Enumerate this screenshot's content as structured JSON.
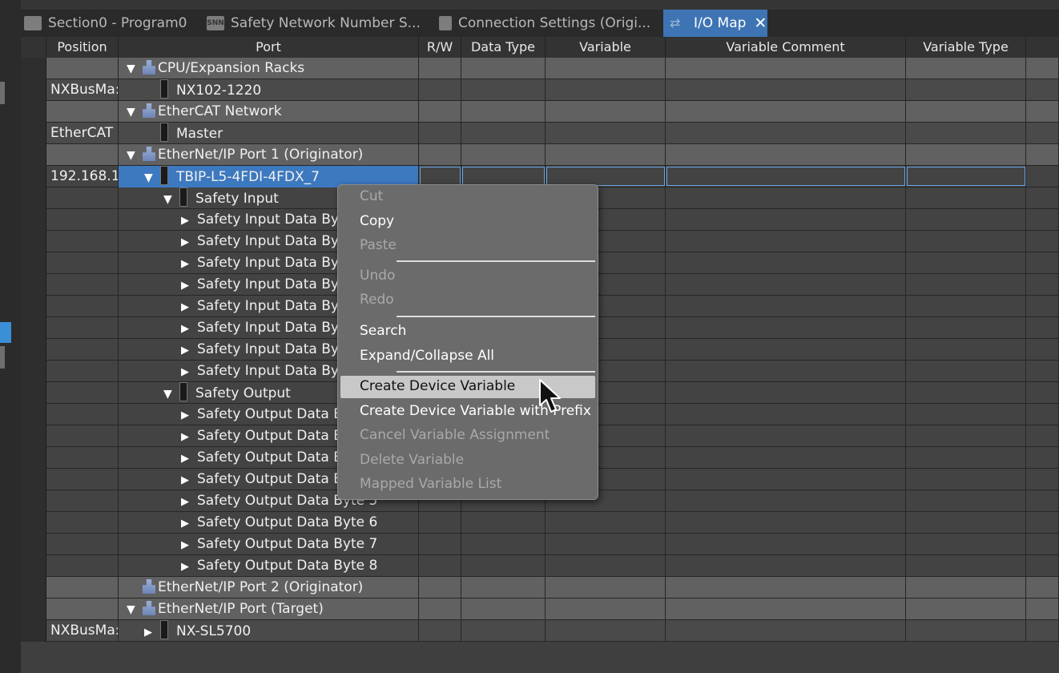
{
  "tabs": [
    {
      "label": "Section0 - Program0",
      "icon": "program-icon",
      "active": false
    },
    {
      "label": "Safety Network Number S...",
      "icon": "snn-icon",
      "badge": "SNN",
      "active": false
    },
    {
      "label": "Connection Settings (Origi...",
      "icon": "connection-icon",
      "active": false
    },
    {
      "label": "I/O Map",
      "icon": "io-map-icon",
      "active": true,
      "close": "✕"
    }
  ],
  "columns": [
    "Position",
    "Port",
    "R/W",
    "Data Type",
    "Variable",
    "Variable Comment",
    "Variable Type"
  ],
  "rows": [
    {
      "type": "cat",
      "position": "",
      "port": "CPU/Expansion Racks",
      "level": 0,
      "expander": "▼",
      "icon": "net"
    },
    {
      "type": "dev",
      "position": "NXBusMa:",
      "port": "NX102-1220",
      "level": 1,
      "expander": "",
      "icon": "dev"
    },
    {
      "type": "cat",
      "position": "",
      "port": "EtherCAT Network",
      "level": 0,
      "expander": "▼",
      "icon": "net"
    },
    {
      "type": "dev",
      "position": "EtherCAT I",
      "port": "Master",
      "level": 1,
      "expander": "",
      "icon": "dev"
    },
    {
      "type": "cat",
      "position": "",
      "port": "EtherNet/IP Port 1 (Originator)",
      "level": 0,
      "expander": "▼",
      "icon": "net"
    },
    {
      "type": "sel",
      "position": "192.168.1.",
      "port": "TBIP-L5-4FDI-4FDX_7",
      "level": 1,
      "expander": "▼",
      "icon": "dev"
    },
    {
      "type": "plain",
      "position": "",
      "port": "Safety Input",
      "level": 2,
      "expander": "▼",
      "icon": "dev"
    },
    {
      "type": "plain",
      "position": "",
      "port": "Safety Input Data Byte 1",
      "level": 3,
      "expander": "▶",
      "icon": ""
    },
    {
      "type": "plain",
      "position": "",
      "port": "Safety Input Data Byte 2",
      "level": 3,
      "expander": "▶",
      "icon": ""
    },
    {
      "type": "plain",
      "position": "",
      "port": "Safety Input Data Byte 3",
      "level": 3,
      "expander": "▶",
      "icon": ""
    },
    {
      "type": "plain",
      "position": "",
      "port": "Safety Input Data Byte 4",
      "level": 3,
      "expander": "▶",
      "icon": ""
    },
    {
      "type": "plain",
      "position": "",
      "port": "Safety Input Data Byte 5",
      "level": 3,
      "expander": "▶",
      "icon": ""
    },
    {
      "type": "plain",
      "position": "",
      "port": "Safety Input Data Byte 6",
      "level": 3,
      "expander": "▶",
      "icon": ""
    },
    {
      "type": "plain",
      "position": "",
      "port": "Safety Input Data Byte 7",
      "level": 3,
      "expander": "▶",
      "icon": ""
    },
    {
      "type": "plain",
      "position": "",
      "port": "Safety Input Data Byte 8",
      "level": 3,
      "expander": "▶",
      "icon": ""
    },
    {
      "type": "plain",
      "position": "",
      "port": "Safety Output",
      "level": 2,
      "expander": "▼",
      "icon": "dev"
    },
    {
      "type": "plain",
      "position": "",
      "port": "Safety Output Data Byte 1",
      "level": 3,
      "expander": "▶",
      "icon": ""
    },
    {
      "type": "plain",
      "position": "",
      "port": "Safety Output Data Byte 2",
      "level": 3,
      "expander": "▶",
      "icon": ""
    },
    {
      "type": "plain",
      "position": "",
      "port": "Safety Output Data Byte 3",
      "level": 3,
      "expander": "▶",
      "icon": ""
    },
    {
      "type": "plain",
      "position": "",
      "port": "Safety Output Data Byte 4",
      "level": 3,
      "expander": "▶",
      "icon": ""
    },
    {
      "type": "plain",
      "position": "",
      "port": "Safety Output Data Byte 5",
      "level": 3,
      "expander": "▶",
      "icon": ""
    },
    {
      "type": "plain",
      "position": "",
      "port": "Safety Output Data Byte 6",
      "level": 3,
      "expander": "▶",
      "icon": ""
    },
    {
      "type": "plain",
      "position": "",
      "port": "Safety Output Data Byte 7",
      "level": 3,
      "expander": "▶",
      "icon": ""
    },
    {
      "type": "plain",
      "position": "",
      "port": "Safety Output Data Byte 8",
      "level": 3,
      "expander": "▶",
      "icon": ""
    },
    {
      "type": "cat",
      "position": "",
      "port": "EtherNet/IP Port 2 (Originator)",
      "level": 0,
      "expander": "",
      "icon": "net"
    },
    {
      "type": "cat",
      "position": "",
      "port": "EtherNet/IP Port (Target)",
      "level": 0,
      "expander": "▼",
      "icon": "net"
    },
    {
      "type": "dev",
      "position": "NXBusMa:",
      "port": "NX-SL5700",
      "level": 1,
      "expander": "▶",
      "icon": "dev"
    }
  ],
  "context_menu": {
    "cut": "Cut",
    "copy": "Copy",
    "paste": "Paste",
    "undo": "Undo",
    "redo": "Redo",
    "search": "Search",
    "expand_collapse_all": "Expand/Collapse All",
    "create_device_variable": "Create Device Variable",
    "create_device_variable_prefix": "Create Device Variable with Prefix",
    "cancel_variable_assignment": "Cancel Variable Assignment",
    "delete_variable": "Delete Variable",
    "mapped_variable_list": "Mapped Variable List"
  },
  "colors": {
    "active_tab": "#3e74b4",
    "selection": "#3d79bf",
    "category_row": "#616161"
  }
}
